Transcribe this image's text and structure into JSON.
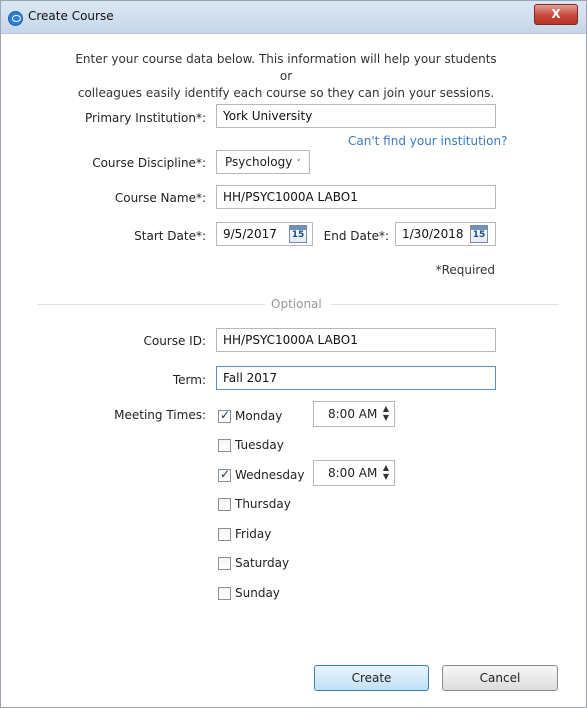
{
  "window": {
    "title": "Create Course",
    "close_label": "X"
  },
  "intro": {
    "line1": "Enter your course data below. This information will help your students or",
    "line2": "colleagues easily identify each course so they can join your sessions."
  },
  "form": {
    "institution_label": "Primary Institution*:",
    "institution_value": "York University",
    "cant_find_link": "Can't find your institution?",
    "discipline_label": "Course Discipline*:",
    "discipline_value": "Psychology",
    "course_name_label": "Course Name*:",
    "course_name_value": "HH/PSYC1000A LABO1",
    "start_date_label": "Start Date*:",
    "start_date_value": "9/5/2017",
    "end_date_label": "End Date*:",
    "end_date_value": "1/30/2018",
    "calendar_day": "15",
    "required_note": "*Required",
    "optional_heading": "Optional",
    "course_id_label": "Course ID:",
    "course_id_value": "HH/PSYC1000A LABO1",
    "term_label": "Term:",
    "term_value": "Fall 2017",
    "meeting_times_label": "Meeting Times:"
  },
  "days": [
    {
      "label": "Monday",
      "checked": true,
      "time": "8:00 AM"
    },
    {
      "label": "Tuesday",
      "checked": false
    },
    {
      "label": "Wednesday",
      "checked": true,
      "time": "8:00 AM"
    },
    {
      "label": "Thursday",
      "checked": false
    },
    {
      "label": "Friday",
      "checked": false
    },
    {
      "label": "Saturday",
      "checked": false
    },
    {
      "label": "Sunday",
      "checked": false
    }
  ],
  "buttons": {
    "create": "Create",
    "cancel": "Cancel"
  },
  "colors": {
    "link": "#3a7bbf",
    "accent": "#2d7fd1",
    "close": "#c9473a"
  }
}
